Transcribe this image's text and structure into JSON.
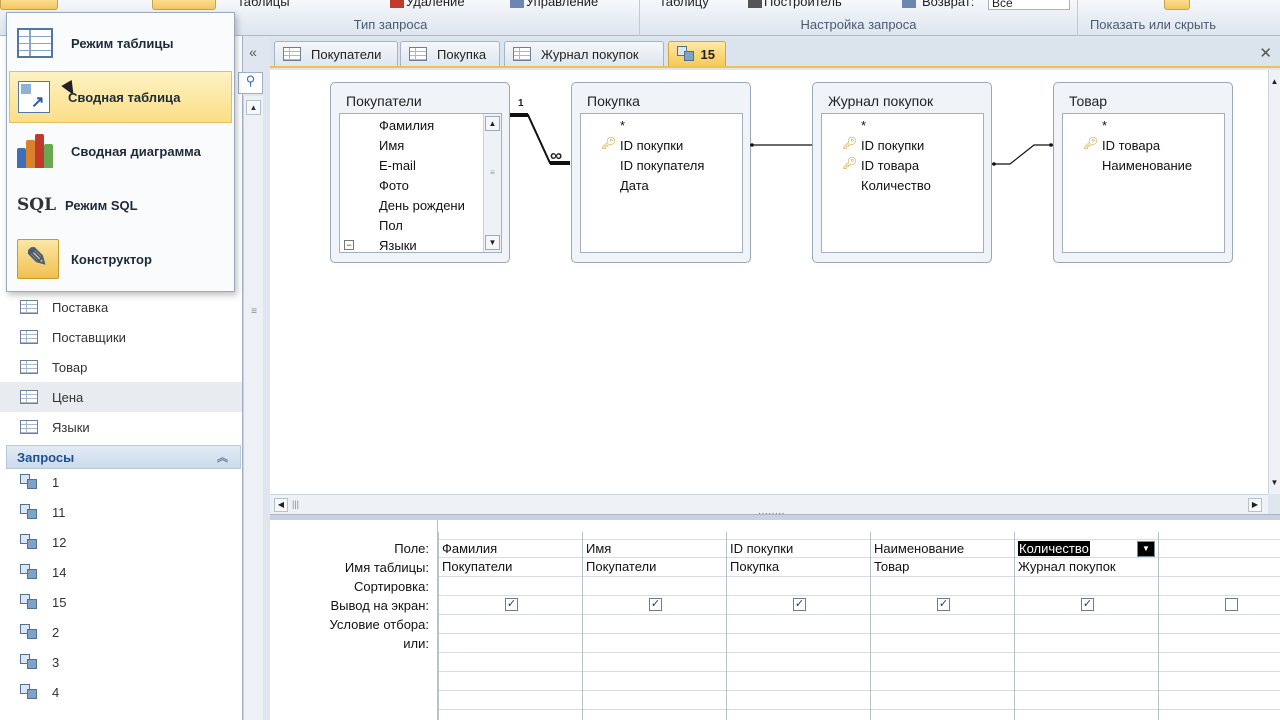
{
  "ribbon": {
    "top_texts": {
      "tables": "таблицы",
      "delete": "Удаление",
      "manage": "Управление",
      "table2": "таблицу",
      "builder": "Построитель",
      "return": "Возврат:",
      "return_value": "Все"
    },
    "groups": {
      "query_type": "Тип запроса",
      "query_setup": "Настройка запроса",
      "show_hide": "Показать или скрыть"
    }
  },
  "view_menu": {
    "items": [
      {
        "label": "Режим таблицы",
        "icon": "datasheet-icon"
      },
      {
        "label": "Сводная таблица",
        "icon": "pivot-table-icon"
      },
      {
        "label": "Сводная диаграмма",
        "icon": "pivot-chart-icon"
      },
      {
        "label": "Режим SQL",
        "icon": "sql-icon",
        "glyph": "SQL"
      },
      {
        "label": "Конструктор",
        "icon": "design-view-icon"
      }
    ]
  },
  "nav": {
    "tables": [
      "Поставка",
      "Поставщики",
      "Товар",
      "Цена",
      "Языки"
    ],
    "selected_table": "Цена",
    "queries_header": "Запросы",
    "queries": [
      "1",
      "11",
      "12",
      "14",
      "15",
      "2",
      "3",
      "4"
    ]
  },
  "tabs": [
    {
      "label": "Покупатели"
    },
    {
      "label": "Покупка"
    },
    {
      "label": "Журнал покупок"
    },
    {
      "label": "15",
      "active": true
    }
  ],
  "tables": [
    {
      "title": "Покупатели",
      "fields": [
        "Фамилия",
        "Имя",
        "E-mail",
        "Фото",
        "День рождени",
        "Пол",
        "Языки"
      ]
    },
    {
      "title": "Покупка",
      "fields": [
        "*",
        "ID покупки",
        "ID покупателя",
        "Дата"
      ],
      "keys": [
        1
      ]
    },
    {
      "title": "Журнал покупок",
      "fields": [
        "*",
        "ID покупки",
        "ID товара",
        "Количество"
      ],
      "keys": [
        1,
        2
      ]
    },
    {
      "title": "Товар",
      "fields": [
        "*",
        "ID товара",
        "Наименование"
      ],
      "keys": [
        1
      ]
    }
  ],
  "relation": {
    "one": "1",
    "many": "∞"
  },
  "grid": {
    "row_labels": [
      "Поле:",
      "Имя таблицы:",
      "Сортировка:",
      "Вывод на экран:",
      "Условие отбора:",
      "или:"
    ],
    "columns": [
      {
        "field": "Фамилия",
        "table": "Покупатели",
        "show": true
      },
      {
        "field": "Имя",
        "table": "Покупатели",
        "show": true
      },
      {
        "field": "ID покупки",
        "table": "Покупка",
        "show": true
      },
      {
        "field": "Наименование",
        "table": "Товар",
        "show": true
      },
      {
        "field": "Количество",
        "table": "Журнал покупок",
        "show": true,
        "selected": true
      },
      {
        "field": "",
        "table": "",
        "show": false
      }
    ]
  },
  "colors": {
    "accent": "#f6c955",
    "selection": "#e8ebf0",
    "nav_header": "#1d4f91"
  }
}
